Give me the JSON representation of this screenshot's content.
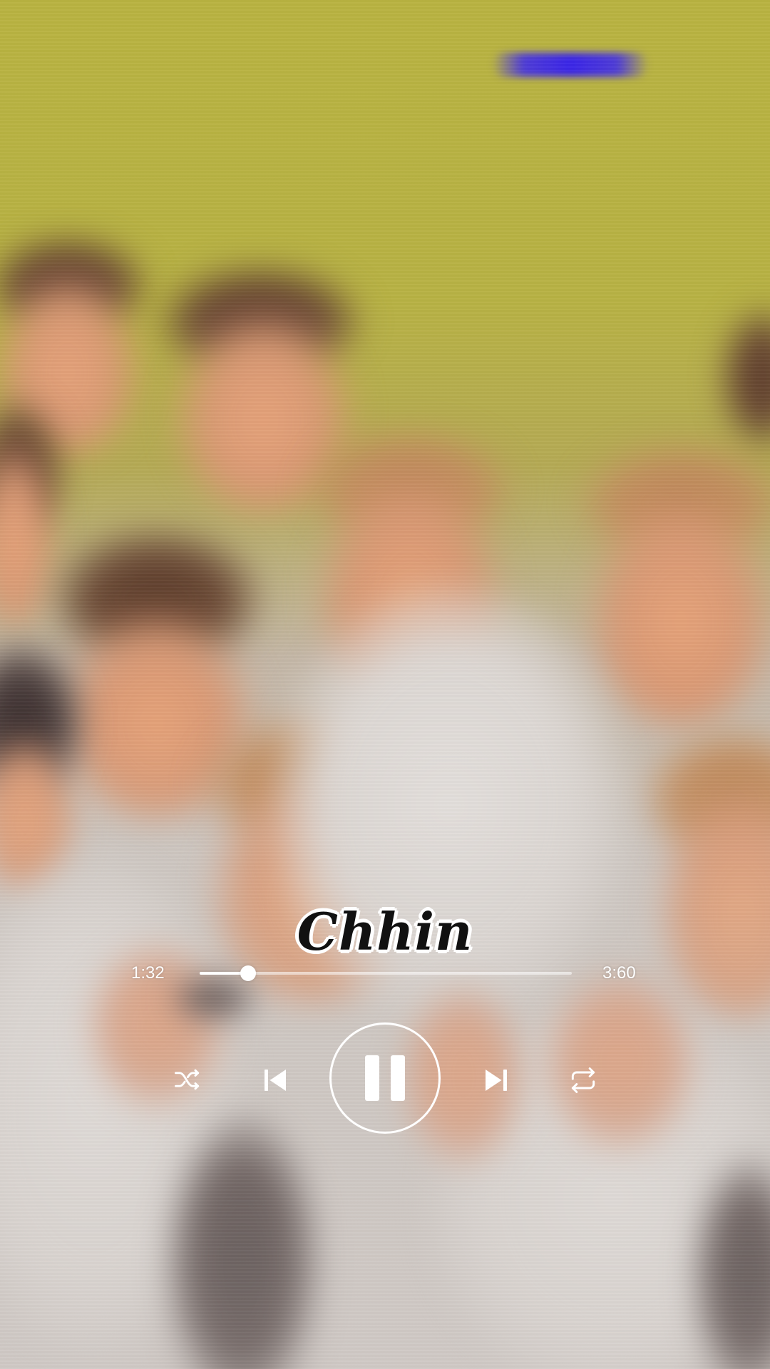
{
  "player": {
    "song_title": "Chhin",
    "time_elapsed": "1:32",
    "time_total": "3:60",
    "progress_fraction": 0.13,
    "state": "playing"
  },
  "controls": {
    "shuffle_icon": "shuffle-icon",
    "previous_icon": "skip-previous-icon",
    "play_pause_icon": "pause-icon",
    "next_icon": "skip-next-icon",
    "repeat_icon": "repeat-icon"
  },
  "colors": {
    "wall": "#b9b341",
    "accent": "#ffffff",
    "glitch": "#3a25e8"
  }
}
